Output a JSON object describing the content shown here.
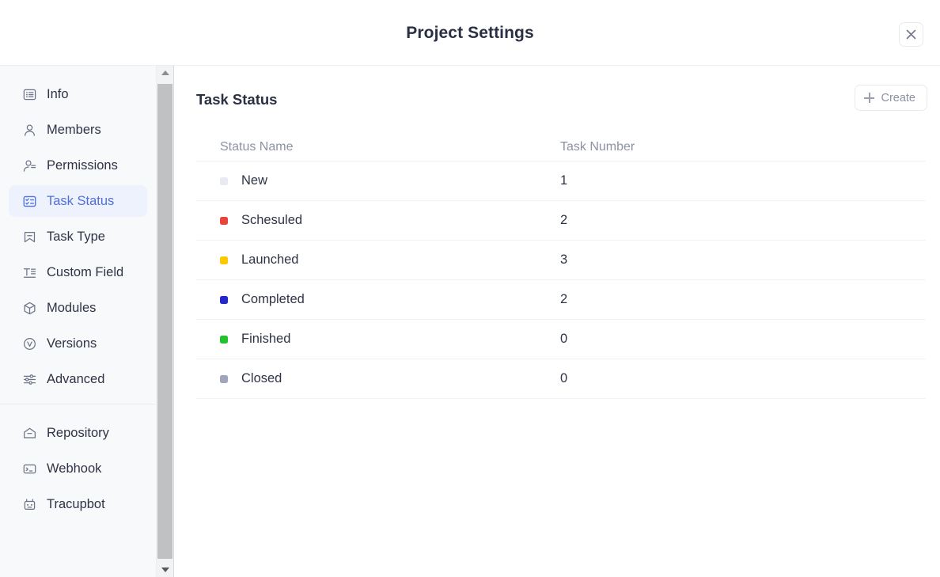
{
  "header": {
    "title": "Project Settings",
    "close_icon": "close-icon"
  },
  "sidebar": {
    "groups": [
      {
        "items": [
          {
            "label": "Info",
            "icon": "list-box-icon",
            "active": false
          },
          {
            "label": "Members",
            "icon": "user-icon",
            "active": false
          },
          {
            "label": "Permissions",
            "icon": "user-key-icon",
            "active": false
          },
          {
            "label": "Task Status",
            "icon": "checklist-box-icon",
            "active": true
          },
          {
            "label": "Task Type",
            "icon": "bookmark-icon",
            "active": false
          },
          {
            "label": "Custom Field",
            "icon": "text-field-icon",
            "active": false
          },
          {
            "label": "Modules",
            "icon": "cube-icon",
            "active": false
          },
          {
            "label": "Versions",
            "icon": "version-clock-icon",
            "active": false
          },
          {
            "label": "Advanced",
            "icon": "sliders-icon",
            "active": false
          }
        ]
      },
      {
        "items": [
          {
            "label": "Repository",
            "icon": "repository-icon",
            "active": false
          },
          {
            "label": "Webhook",
            "icon": "terminal-card-icon",
            "active": false
          },
          {
            "label": "Tracupbot",
            "icon": "robot-icon",
            "active": false
          }
        ]
      }
    ],
    "scrollbar": {
      "up_icon": "scroll-up-arrow-icon",
      "down_icon": "scroll-down-arrow-icon"
    }
  },
  "main": {
    "section_title": "Task Status",
    "create_button": {
      "label": "Create",
      "icon": "plus-icon"
    },
    "table": {
      "columns": [
        "Status Name",
        "Task Number"
      ],
      "rows": [
        {
          "name": "New",
          "count": "1",
          "color": "#e8eaf1"
        },
        {
          "name": "Schesuled",
          "count": "2",
          "color": "#e8453c"
        },
        {
          "name": "Launched",
          "count": "3",
          "color": "#fcc800"
        },
        {
          "name": "Completed",
          "count": "2",
          "color": "#2429c8"
        },
        {
          "name": "Finished",
          "count": "0",
          "color": "#22c32e"
        },
        {
          "name": "Closed",
          "count": "0",
          "color": "#a0a5b8"
        }
      ]
    }
  },
  "theme": {
    "accent": "#4f6fe0",
    "accent_bg": "#eef2fd",
    "sidebar_bg": "#f8f9fb",
    "text": "#2f3346",
    "muted": "#8c92a4",
    "border": "#eceef2"
  }
}
